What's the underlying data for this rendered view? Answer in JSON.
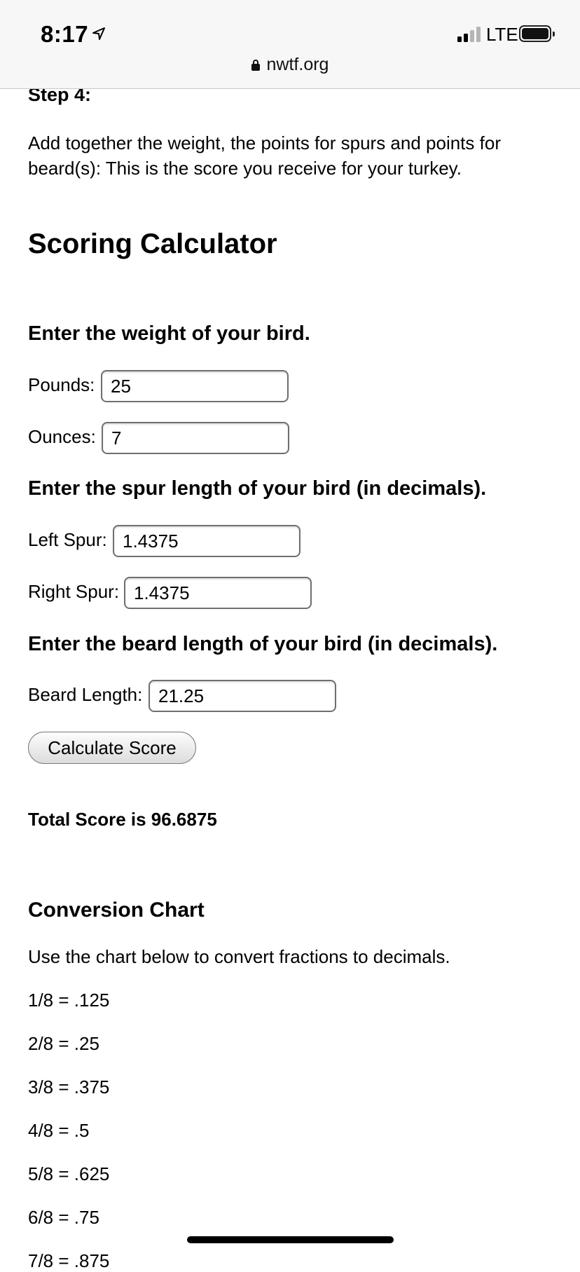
{
  "status_bar": {
    "time": "8:17",
    "network": "LTE"
  },
  "browser": {
    "url": "nwtf.org"
  },
  "page": {
    "step_heading": "Step 4:",
    "step_text": "Add together the weight, the points for spurs and points for beard(s): This is the score you receive for your turkey.",
    "calculator_title": "Scoring Calculator",
    "weight_heading": "Enter the weight of your bird.",
    "pounds_label": "Pounds:",
    "pounds_value": "25",
    "ounces_label": "Ounces:",
    "ounces_value": "7",
    "spur_heading": "Enter the spur length of your bird (in decimals).",
    "left_spur_label": "Left Spur:",
    "left_spur_value": "1.4375",
    "right_spur_label": "Right Spur:",
    "right_spur_value": "1.4375",
    "beard_heading": "Enter the beard length of your bird (in decimals).",
    "beard_label": "Beard Length:",
    "beard_value": "21.25",
    "calculate_button": "Calculate Score",
    "total_score": "Total Score is 96.6875",
    "conversion_title": "Conversion Chart",
    "conversion_desc": "Use the chart below to convert fractions to decimals.",
    "conversions": [
      "1/8 = .125",
      "2/8 = .25",
      "3/8 = .375",
      "4/8 = .5",
      "5/8 = .625",
      "6/8 = .75",
      "7/8 = .875"
    ]
  },
  "icons": {
    "location": "location-arrow-icon",
    "signal": "cellular-signal-icon",
    "battery": "battery-icon",
    "lock": "lock-icon"
  }
}
